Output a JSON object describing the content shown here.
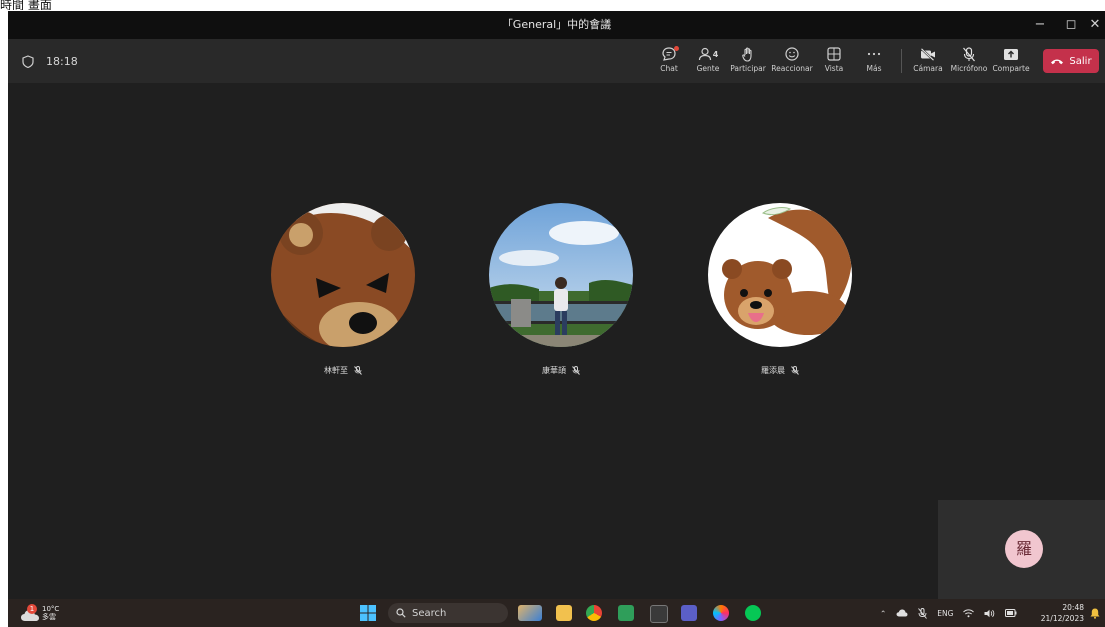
{
  "caption": "時間 畫面",
  "window": {
    "title": "「General」中的會議",
    "minimize_glyph": "−",
    "maximize_glyph": "◻",
    "close_glyph": "✕"
  },
  "toolbar": {
    "timer": "18:18",
    "chat": "Chat",
    "people": "Gente",
    "people_count": "4",
    "raise_hand": "Participar",
    "react": "Reaccionar",
    "view": "Vista",
    "more": "Más",
    "camera": "Cámara",
    "mic": "Micrófono",
    "share": "Comparte",
    "leave": "Salir"
  },
  "participants": [
    {
      "name": "林軒至"
    },
    {
      "name": "康華頡"
    },
    {
      "name": "羅添晨"
    }
  ],
  "self_view": {
    "initial": "羅"
  },
  "taskbar": {
    "weather_temp": "10°C",
    "weather_desc": "多雲",
    "weather_alert": "1",
    "search_placeholder": "Search",
    "language": "ENG",
    "time": "20:48",
    "date": "21/12/2023"
  },
  "colors": {
    "leave": "#c4314b",
    "stage_bg": "#1f1f1f",
    "chat_dot": "#e3493a",
    "self_avatar_bg": "#f1c6cf"
  }
}
